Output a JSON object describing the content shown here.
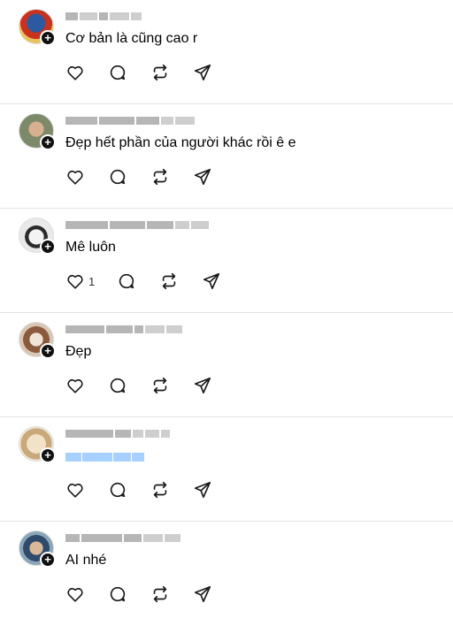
{
  "posts": [
    {
      "text": "Cơ bản là cũng cao r",
      "like_count": ""
    },
    {
      "text": "Đẹp hết phần của người khác rồi ê e",
      "like_count": ""
    },
    {
      "text": "Mê luôn",
      "like_count": "1"
    },
    {
      "text": "Đẹp",
      "like_count": ""
    },
    {
      "text": "",
      "like_count": ""
    },
    {
      "text": "AI nhé",
      "like_count": ""
    }
  ],
  "icons": {
    "like": "heart-icon",
    "reply": "comment-icon",
    "repost": "repost-icon",
    "share": "send-icon",
    "follow": "plus-icon"
  }
}
